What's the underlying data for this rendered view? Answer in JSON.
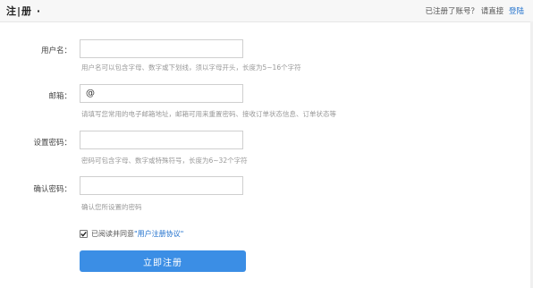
{
  "header": {
    "brand": "注|册 ·",
    "has_account_text": "已注册了账号？",
    "login_prompt": "请直接",
    "login_link": "登陆"
  },
  "form": {
    "username": {
      "label": "用户名：",
      "value": "",
      "hint": "用户名可以包含字母、数字或下划线，须以字母开头，长度为5~16个字符"
    },
    "email": {
      "label": "邮箱：",
      "value": "@",
      "hint": "请填写您常用的电子邮箱地址，邮箱可用来重置密码、接收订单状态信息、订单状态等"
    },
    "password": {
      "label": "设置密码：",
      "value": "",
      "hint": "密码可包含字母、数字或特殊符号，长度为6~32个字符"
    },
    "confirm": {
      "label": "确认密码：",
      "value": "",
      "hint": "确认您所设置的密码"
    },
    "agreement": {
      "checked": true,
      "text": "已阅读并同意",
      "link": "\"用户注册协议\""
    },
    "submit_label": "立即注册"
  },
  "colors": {
    "accent": "#3b8ee5",
    "link": "#1e6fcc"
  }
}
